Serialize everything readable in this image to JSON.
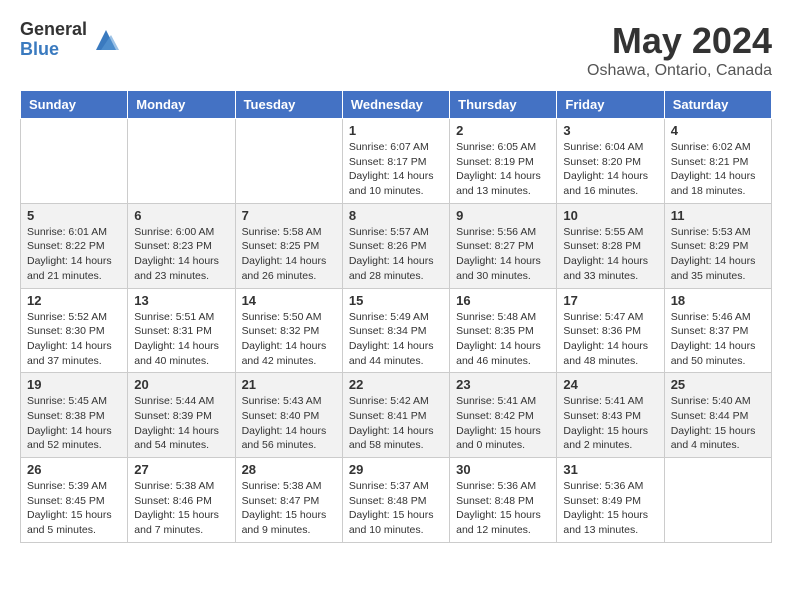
{
  "logo": {
    "general": "General",
    "blue": "Blue"
  },
  "title": "May 2024",
  "subtitle": "Oshawa, Ontario, Canada",
  "days_of_week": [
    "Sunday",
    "Monday",
    "Tuesday",
    "Wednesday",
    "Thursday",
    "Friday",
    "Saturday"
  ],
  "weeks": [
    {
      "shaded": false,
      "days": [
        {
          "num": "",
          "sunrise": "",
          "sunset": "",
          "daylight": ""
        },
        {
          "num": "",
          "sunrise": "",
          "sunset": "",
          "daylight": ""
        },
        {
          "num": "",
          "sunrise": "",
          "sunset": "",
          "daylight": ""
        },
        {
          "num": "1",
          "sunrise": "Sunrise: 6:07 AM",
          "sunset": "Sunset: 8:17 PM",
          "daylight": "Daylight: 14 hours and 10 minutes."
        },
        {
          "num": "2",
          "sunrise": "Sunrise: 6:05 AM",
          "sunset": "Sunset: 8:19 PM",
          "daylight": "Daylight: 14 hours and 13 minutes."
        },
        {
          "num": "3",
          "sunrise": "Sunrise: 6:04 AM",
          "sunset": "Sunset: 8:20 PM",
          "daylight": "Daylight: 14 hours and 16 minutes."
        },
        {
          "num": "4",
          "sunrise": "Sunrise: 6:02 AM",
          "sunset": "Sunset: 8:21 PM",
          "daylight": "Daylight: 14 hours and 18 minutes."
        }
      ]
    },
    {
      "shaded": true,
      "days": [
        {
          "num": "5",
          "sunrise": "Sunrise: 6:01 AM",
          "sunset": "Sunset: 8:22 PM",
          "daylight": "Daylight: 14 hours and 21 minutes."
        },
        {
          "num": "6",
          "sunrise": "Sunrise: 6:00 AM",
          "sunset": "Sunset: 8:23 PM",
          "daylight": "Daylight: 14 hours and 23 minutes."
        },
        {
          "num": "7",
          "sunrise": "Sunrise: 5:58 AM",
          "sunset": "Sunset: 8:25 PM",
          "daylight": "Daylight: 14 hours and 26 minutes."
        },
        {
          "num": "8",
          "sunrise": "Sunrise: 5:57 AM",
          "sunset": "Sunset: 8:26 PM",
          "daylight": "Daylight: 14 hours and 28 minutes."
        },
        {
          "num": "9",
          "sunrise": "Sunrise: 5:56 AM",
          "sunset": "Sunset: 8:27 PM",
          "daylight": "Daylight: 14 hours and 30 minutes."
        },
        {
          "num": "10",
          "sunrise": "Sunrise: 5:55 AM",
          "sunset": "Sunset: 8:28 PM",
          "daylight": "Daylight: 14 hours and 33 minutes."
        },
        {
          "num": "11",
          "sunrise": "Sunrise: 5:53 AM",
          "sunset": "Sunset: 8:29 PM",
          "daylight": "Daylight: 14 hours and 35 minutes."
        }
      ]
    },
    {
      "shaded": false,
      "days": [
        {
          "num": "12",
          "sunrise": "Sunrise: 5:52 AM",
          "sunset": "Sunset: 8:30 PM",
          "daylight": "Daylight: 14 hours and 37 minutes."
        },
        {
          "num": "13",
          "sunrise": "Sunrise: 5:51 AM",
          "sunset": "Sunset: 8:31 PM",
          "daylight": "Daylight: 14 hours and 40 minutes."
        },
        {
          "num": "14",
          "sunrise": "Sunrise: 5:50 AM",
          "sunset": "Sunset: 8:32 PM",
          "daylight": "Daylight: 14 hours and 42 minutes."
        },
        {
          "num": "15",
          "sunrise": "Sunrise: 5:49 AM",
          "sunset": "Sunset: 8:34 PM",
          "daylight": "Daylight: 14 hours and 44 minutes."
        },
        {
          "num": "16",
          "sunrise": "Sunrise: 5:48 AM",
          "sunset": "Sunset: 8:35 PM",
          "daylight": "Daylight: 14 hours and 46 minutes."
        },
        {
          "num": "17",
          "sunrise": "Sunrise: 5:47 AM",
          "sunset": "Sunset: 8:36 PM",
          "daylight": "Daylight: 14 hours and 48 minutes."
        },
        {
          "num": "18",
          "sunrise": "Sunrise: 5:46 AM",
          "sunset": "Sunset: 8:37 PM",
          "daylight": "Daylight: 14 hours and 50 minutes."
        }
      ]
    },
    {
      "shaded": true,
      "days": [
        {
          "num": "19",
          "sunrise": "Sunrise: 5:45 AM",
          "sunset": "Sunset: 8:38 PM",
          "daylight": "Daylight: 14 hours and 52 minutes."
        },
        {
          "num": "20",
          "sunrise": "Sunrise: 5:44 AM",
          "sunset": "Sunset: 8:39 PM",
          "daylight": "Daylight: 14 hours and 54 minutes."
        },
        {
          "num": "21",
          "sunrise": "Sunrise: 5:43 AM",
          "sunset": "Sunset: 8:40 PM",
          "daylight": "Daylight: 14 hours and 56 minutes."
        },
        {
          "num": "22",
          "sunrise": "Sunrise: 5:42 AM",
          "sunset": "Sunset: 8:41 PM",
          "daylight": "Daylight: 14 hours and 58 minutes."
        },
        {
          "num": "23",
          "sunrise": "Sunrise: 5:41 AM",
          "sunset": "Sunset: 8:42 PM",
          "daylight": "Daylight: 15 hours and 0 minutes."
        },
        {
          "num": "24",
          "sunrise": "Sunrise: 5:41 AM",
          "sunset": "Sunset: 8:43 PM",
          "daylight": "Daylight: 15 hours and 2 minutes."
        },
        {
          "num": "25",
          "sunrise": "Sunrise: 5:40 AM",
          "sunset": "Sunset: 8:44 PM",
          "daylight": "Daylight: 15 hours and 4 minutes."
        }
      ]
    },
    {
      "shaded": false,
      "days": [
        {
          "num": "26",
          "sunrise": "Sunrise: 5:39 AM",
          "sunset": "Sunset: 8:45 PM",
          "daylight": "Daylight: 15 hours and 5 minutes."
        },
        {
          "num": "27",
          "sunrise": "Sunrise: 5:38 AM",
          "sunset": "Sunset: 8:46 PM",
          "daylight": "Daylight: 15 hours and 7 minutes."
        },
        {
          "num": "28",
          "sunrise": "Sunrise: 5:38 AM",
          "sunset": "Sunset: 8:47 PM",
          "daylight": "Daylight: 15 hours and 9 minutes."
        },
        {
          "num": "29",
          "sunrise": "Sunrise: 5:37 AM",
          "sunset": "Sunset: 8:48 PM",
          "daylight": "Daylight: 15 hours and 10 minutes."
        },
        {
          "num": "30",
          "sunrise": "Sunrise: 5:36 AM",
          "sunset": "Sunset: 8:48 PM",
          "daylight": "Daylight: 15 hours and 12 minutes."
        },
        {
          "num": "31",
          "sunrise": "Sunrise: 5:36 AM",
          "sunset": "Sunset: 8:49 PM",
          "daylight": "Daylight: 15 hours and 13 minutes."
        },
        {
          "num": "",
          "sunrise": "",
          "sunset": "",
          "daylight": ""
        }
      ]
    }
  ]
}
